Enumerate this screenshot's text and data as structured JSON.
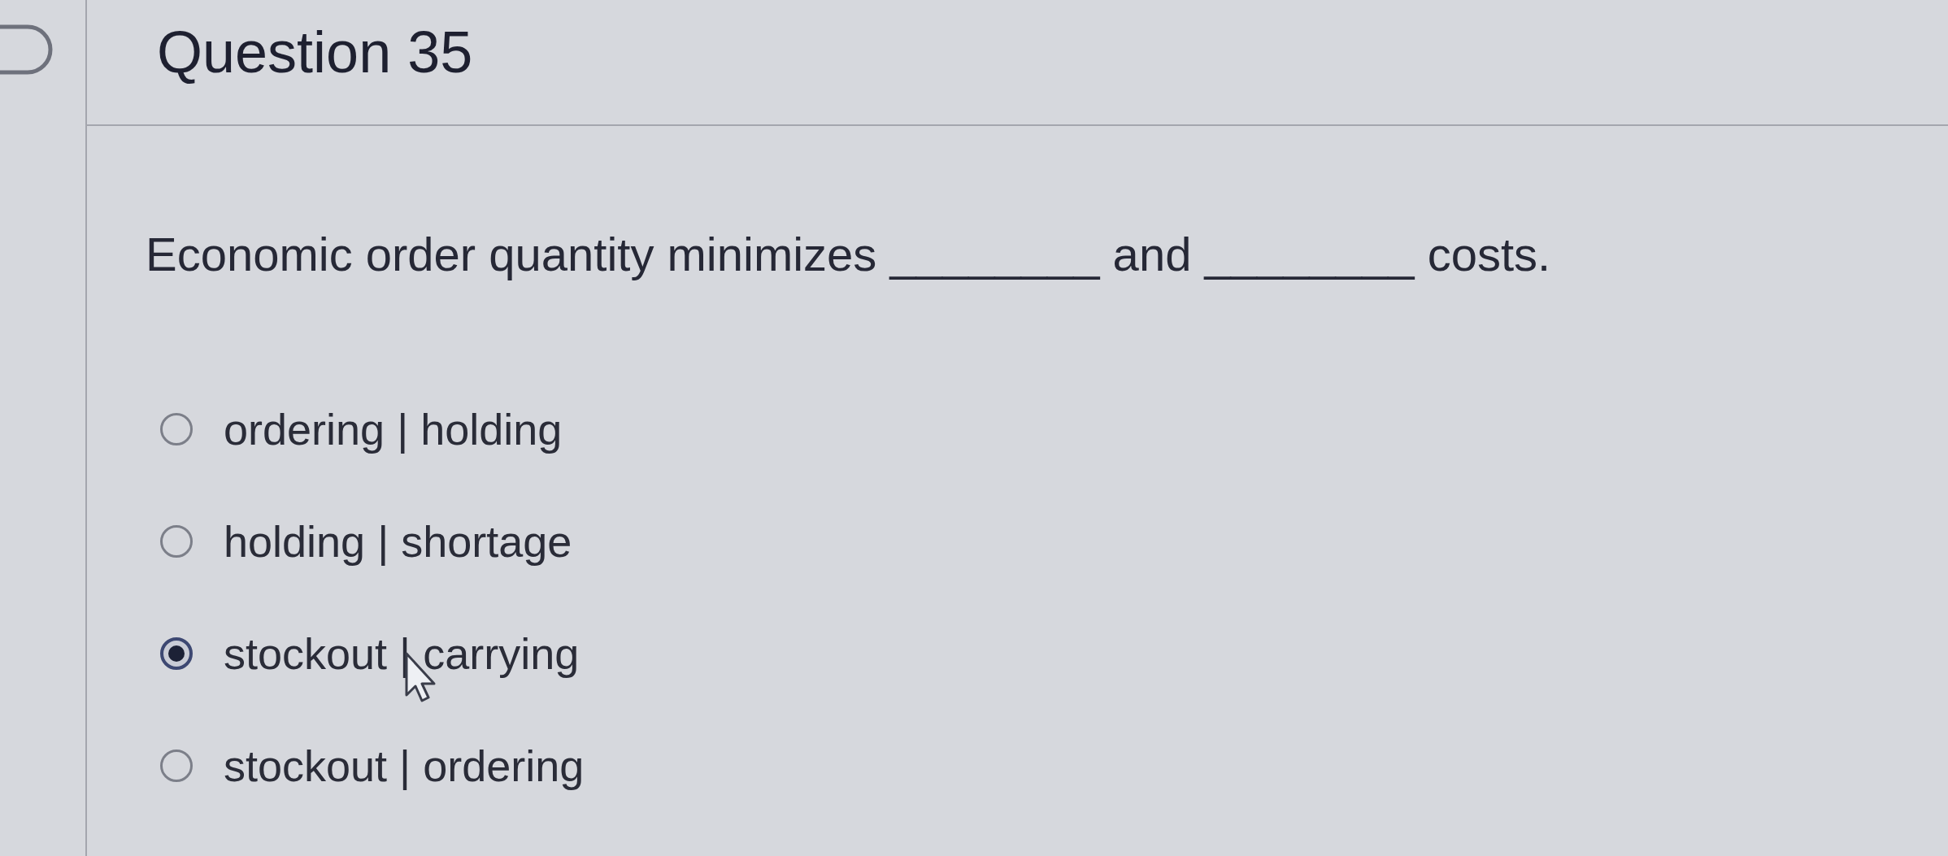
{
  "question": {
    "title": "Question 35",
    "text": "Economic order quantity minimizes ________ and ________ costs.",
    "options": [
      {
        "label": "ordering | holding",
        "selected": false
      },
      {
        "label": "holding | shortage",
        "selected": false
      },
      {
        "label": "stockout | carrying",
        "selected": true
      },
      {
        "label": "stockout | ordering",
        "selected": false
      }
    ]
  }
}
